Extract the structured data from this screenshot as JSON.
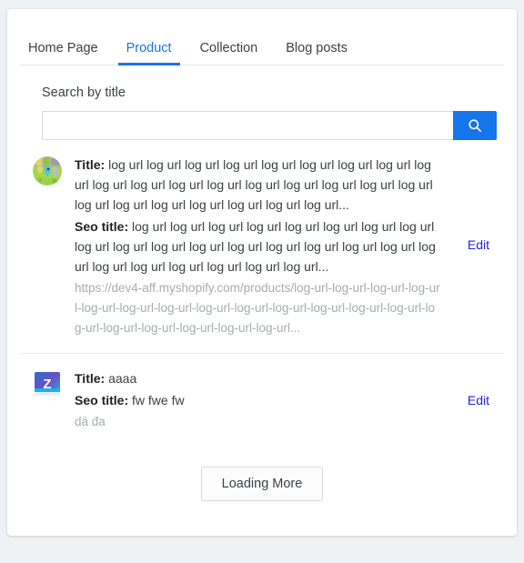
{
  "tabs": [
    {
      "label": "Home Page",
      "active": false
    },
    {
      "label": "Product",
      "active": true
    },
    {
      "label": "Collection",
      "active": false
    },
    {
      "label": "Blog posts",
      "active": false
    }
  ],
  "search": {
    "label": "Search by title",
    "value": "",
    "placeholder": "",
    "button_icon": "search-icon",
    "button_color": "#1575ec"
  },
  "labels": {
    "title": "Title:",
    "seo_title": "Seo title:",
    "edit": "Edit"
  },
  "items": [
    {
      "thumb": "product-image-thumbnail",
      "thumb_shape": "round",
      "title": "log url log url log url log url log url log url log url log url log url log url log url log url log url log url log url log url log url log url log url log url log url log url log url log url log url...",
      "seo_title": "log url log url log url log url log url log url log url log url log url log url log url log url log url log url log url log url log url log url log url log url log url log url log url log url...",
      "url": "https://dev4-aff.myshopify.com/products/log-url-log-url-log-url-log-url-log-url-log-url-log-url-log-url-log-url-log-url-log-url-log-url-log-url-log-url-log-url-log-url-log-url-log-url-log-url...",
      "edit": "Edit"
    },
    {
      "thumb": "z-logo-thumbnail",
      "thumb_shape": "square",
      "title": "aaaa",
      "seo_title": "fw fwe fw",
      "url": "dá đa",
      "edit": "Edit"
    }
  ],
  "footer": {
    "load_more_label": "Loading More"
  },
  "colors": {
    "accent": "#1a73e8",
    "search_button": "#1575ec",
    "link": "#2323dc",
    "muted_text": "#a7acb1",
    "page_background": "#eef2f5"
  }
}
